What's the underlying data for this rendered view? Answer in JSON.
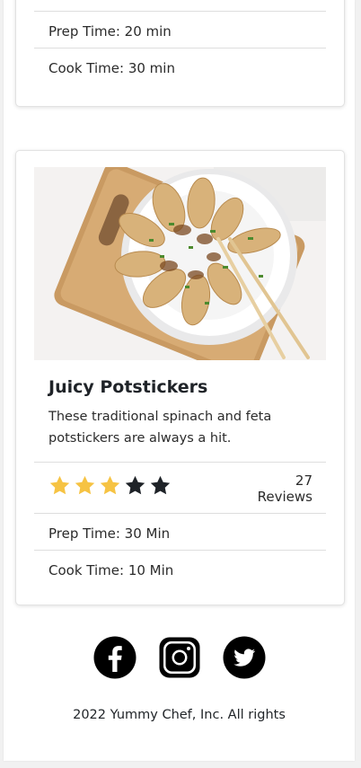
{
  "previous_card": {
    "prep_time": "Prep Time: 20 min",
    "cook_time": "Cook Time: 30 min"
  },
  "recipe": {
    "image_alt": "Potstickers on a plate with chopsticks",
    "title": "Juicy Potstickers",
    "description": "These traditional spinach and feta potstickers are always a hit.",
    "rating": 3,
    "rating_max": 5,
    "reviews": "27 Reviews",
    "prep_time": "Prep Time: 30 Min",
    "cook_time": "Cook Time: 10 Min"
  },
  "social": {
    "icons": [
      "facebook-icon",
      "instagram-icon",
      "twitter-icon"
    ]
  },
  "footer": {
    "copyright": "2022 Yummy Chef, Inc. All rights"
  },
  "colors": {
    "star_filled": "#f6c343",
    "star_empty": "#1f2328"
  }
}
